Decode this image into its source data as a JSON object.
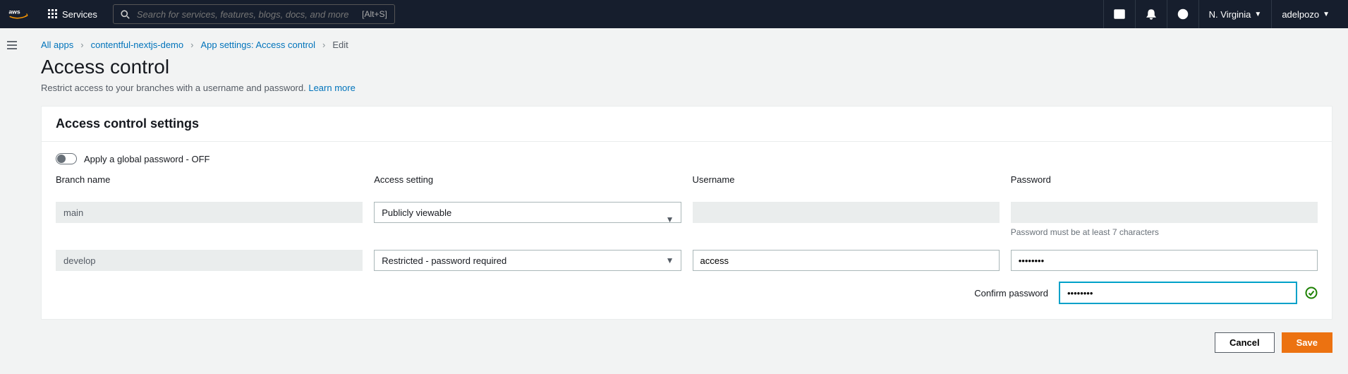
{
  "topnav": {
    "services_label": "Services",
    "search_placeholder": "Search for services, features, blogs, docs, and more",
    "search_shortcut": "[Alt+S]",
    "region": "N. Virginia",
    "user": "adelpozo"
  },
  "breadcrumbs": {
    "all_apps": "All apps",
    "app_name": "contentful-nextjs-demo",
    "settings": "App settings: Access control",
    "current": "Edit"
  },
  "page": {
    "title": "Access control",
    "description": "Restrict access to your branches with a username and password. ",
    "learn_more": "Learn more"
  },
  "panel": {
    "header": "Access control settings",
    "global_toggle_label": "Apply a global password - OFF",
    "headers": {
      "branch": "Branch name",
      "access": "Access setting",
      "username": "Username",
      "password": "Password"
    },
    "rows": [
      {
        "branch": "main",
        "access": "Publicly viewable",
        "username": "",
        "password": "",
        "password_hint": "Password must be at least 7 characters"
      },
      {
        "branch": "develop",
        "access": "Restricted - password required",
        "username": "access",
        "password": "••••••••",
        "password_hint": ""
      }
    ],
    "confirm": {
      "label": "Confirm password",
      "value": "••••••••"
    }
  },
  "actions": {
    "cancel": "Cancel",
    "save": "Save"
  },
  "icons": {
    "grid": "grid-icon",
    "search": "search-icon",
    "cloudshell": "cloudshell-icon",
    "bell": "bell-icon",
    "help": "help-icon",
    "hamburger": "hamburger-icon",
    "check": "check-ok-icon"
  }
}
